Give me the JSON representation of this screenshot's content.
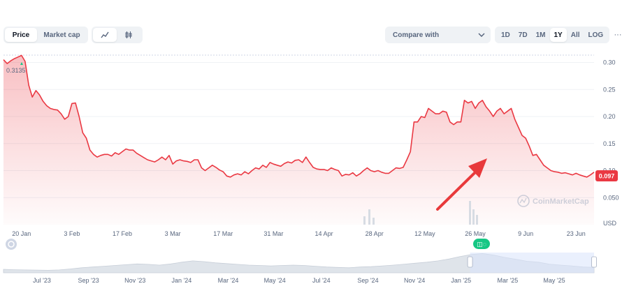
{
  "toolbar": {
    "price_label": "Price",
    "market_cap_label": "Market cap",
    "compare_label": "Compare with",
    "ranges": [
      "1D",
      "7D",
      "1M",
      "1Y",
      "All",
      "LOG"
    ],
    "active_range": "1Y",
    "more_label": "···"
  },
  "badge": {
    "label": "0.097"
  },
  "watermark": "CoinMarketCap",
  "colors": {
    "line": "#ea3943",
    "fill": "#ea3943",
    "badge": "#ea3943",
    "arrow": "#e8393b",
    "grid": "#eff2f5",
    "navigator_fill": "#d5dbe3",
    "navigator_highlight": "#e3ecfd",
    "event_marker": "#16c784"
  },
  "icons": [
    "line-chart-icon",
    "candlestick-icon",
    "chevron-down-icon",
    "event-marker-icon",
    "history-icon",
    "annotation-arrow"
  ],
  "chart_data": {
    "type": "area",
    "max_label": "0.3135",
    "y_unit": "USD",
    "ylim": [
      0.0,
      0.32
    ],
    "y_ticks": [
      0.3,
      0.25,
      0.2,
      0.15,
      0.1,
      0.05
    ],
    "y_tick_labels": [
      "0.30",
      "0.25",
      "0.20",
      "0.15",
      "0.10",
      "0.050"
    ],
    "x_tick_labels": [
      "20 Jan",
      "3 Feb",
      "17 Feb",
      "3 Mar",
      "17 Mar",
      "31 Mar",
      "14 Apr",
      "28 Apr",
      "12 May",
      "26 May",
      "9 Jun",
      "23 Jun"
    ],
    "x_tick_positions": [
      5,
      19,
      33,
      47,
      61,
      75,
      89,
      103,
      117,
      131,
      145,
      159
    ],
    "x_range": [
      0,
      164
    ],
    "series": [
      {
        "x": [
          0,
          1,
          2,
          3,
          4,
          5,
          6,
          7,
          8,
          9,
          10,
          11,
          12,
          13,
          14,
          15,
          16,
          17,
          18,
          19,
          20,
          21,
          22,
          23,
          24,
          25,
          26,
          27,
          28,
          29,
          30,
          31,
          32,
          33,
          34,
          35,
          36,
          37,
          38,
          39,
          40,
          41,
          42,
          43,
          44,
          45,
          46,
          47,
          48,
          49,
          50,
          51,
          52,
          53,
          54,
          55,
          56,
          57,
          58,
          59,
          60,
          61,
          62,
          63,
          64,
          65,
          66,
          67,
          68,
          69,
          70,
          71,
          72,
          73,
          74,
          75,
          76,
          77,
          78,
          79,
          80,
          81,
          82,
          83,
          84,
          85,
          86,
          87,
          88,
          89,
          90,
          91,
          92,
          93,
          94,
          95,
          96,
          97,
          98,
          99,
          100,
          101,
          102,
          103,
          104,
          105,
          106,
          107,
          108,
          109,
          110,
          111,
          112,
          113,
          114,
          115,
          116,
          117,
          118,
          119,
          120,
          121,
          122,
          123,
          124,
          125,
          126,
          127,
          128,
          129,
          130,
          131,
          132,
          133,
          134,
          135,
          136,
          137,
          138,
          139,
          140,
          141,
          142,
          143,
          144,
          145,
          146,
          147,
          148,
          149,
          150,
          151,
          152,
          153,
          154,
          155,
          156,
          157,
          158,
          159,
          160,
          161,
          162,
          163,
          164
        ],
        "values": [
          0.305,
          0.298,
          0.303,
          0.307,
          0.31,
          0.313,
          0.302,
          0.258,
          0.236,
          0.248,
          0.24,
          0.228,
          0.22,
          0.215,
          0.213,
          0.212,
          0.205,
          0.195,
          0.2,
          0.224,
          0.225,
          0.2,
          0.17,
          0.16,
          0.138,
          0.13,
          0.125,
          0.128,
          0.13,
          0.13,
          0.127,
          0.133,
          0.13,
          0.135,
          0.14,
          0.138,
          0.138,
          0.132,
          0.128,
          0.124,
          0.12,
          0.118,
          0.116,
          0.12,
          0.125,
          0.12,
          0.128,
          0.112,
          0.118,
          0.12,
          0.118,
          0.117,
          0.115,
          0.12,
          0.12,
          0.105,
          0.1,
          0.105,
          0.11,
          0.106,
          0.101,
          0.098,
          0.09,
          0.088,
          0.092,
          0.094,
          0.092,
          0.098,
          0.094,
          0.1,
          0.105,
          0.103,
          0.11,
          0.106,
          0.115,
          0.112,
          0.11,
          0.108,
          0.113,
          0.116,
          0.114,
          0.119,
          0.12,
          0.115,
          0.125,
          0.115,
          0.106,
          0.103,
          0.102,
          0.102,
          0.1,
          0.105,
          0.102,
          0.1,
          0.09,
          0.093,
          0.092,
          0.096,
          0.09,
          0.094,
          0.1,
          0.105,
          0.1,
          0.098,
          0.1,
          0.097,
          0.095,
          0.095,
          0.1,
          0.105,
          0.104,
          0.106,
          0.12,
          0.135,
          0.19,
          0.19,
          0.2,
          0.198,
          0.215,
          0.21,
          0.205,
          0.205,
          0.21,
          0.208,
          0.19,
          0.185,
          0.19,
          0.19,
          0.23,
          0.225,
          0.228,
          0.215,
          0.225,
          0.23,
          0.218,
          0.21,
          0.2,
          0.21,
          0.215,
          0.205,
          0.21,
          0.215,
          0.195,
          0.18,
          0.165,
          0.16,
          0.145,
          0.128,
          0.13,
          0.12,
          0.11,
          0.105,
          0.1,
          0.098,
          0.097,
          0.095,
          0.096,
          0.094,
          0.092,
          0.095,
          0.092,
          0.09,
          0.088,
          0.092,
          0.097
        ]
      }
    ],
    "volume": [],
    "navigator": {
      "x_tick_labels": [
        "Jul '23",
        "Sep '23",
        "Nov '23",
        "Jan '24",
        "Mar '24",
        "May '24",
        "Jul '24",
        "Sep '24",
        "Nov '24",
        "Jan '25",
        "Mar '25",
        "May '25"
      ],
      "values": [
        0.18,
        0.16,
        0.15,
        0.14,
        0.13,
        0.15,
        0.2,
        0.26,
        0.3,
        0.34,
        0.38,
        0.42,
        0.46,
        0.44,
        0.4,
        0.46,
        0.55,
        0.62,
        0.58,
        0.52,
        0.48,
        0.44,
        0.4,
        0.38,
        0.36,
        0.38,
        0.4,
        0.38,
        0.34,
        0.3,
        0.28,
        0.26,
        0.3,
        0.32,
        0.36,
        0.4,
        0.45,
        0.5,
        0.55,
        0.62,
        0.72,
        0.85,
        0.95,
        1.0,
        0.92,
        0.8,
        0.7,
        0.6,
        0.55,
        0.45,
        0.4,
        0.36,
        0.3,
        0.28
      ],
      "selected_range": [
        0.79,
        1.0
      ]
    }
  }
}
